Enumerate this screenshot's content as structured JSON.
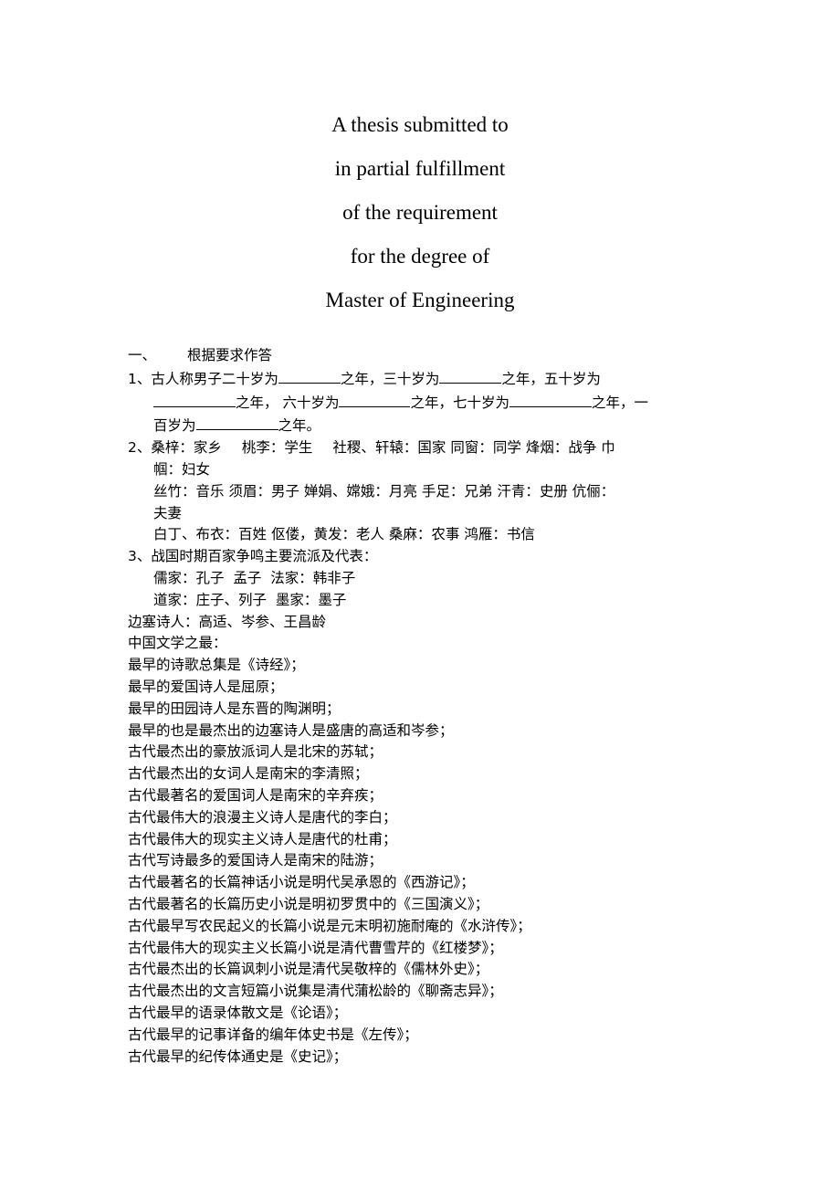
{
  "title_block": {
    "lines": [
      "A thesis submitted to",
      "in partial fulfillment",
      "of the requirement",
      "for the degree of",
      "Master of Engineering"
    ]
  },
  "section": {
    "number": "一、",
    "heading": "根据要求作答"
  },
  "q1": {
    "number": "1、",
    "line1_a": "古人称男子二十岁为",
    "line1_b": "之年，三十岁为",
    "line1_c": "之年，五十岁为",
    "line2_a": "之年，",
    "line2_b": "六十岁为",
    "line2_c": "之年，七十岁为",
    "line2_d": "之年，一",
    "line3_a": "百岁为",
    "line3_b": "之年。"
  },
  "q2": {
    "number": "2、",
    "line1": [
      "桑梓：家乡",
      "桃李：学生",
      "社稷、轩辕：国家",
      "同窗：同学",
      "烽烟：战争",
      "巾"
    ],
    "line2": "帼：妇女",
    "line3": [
      "丝竹：音乐",
      "须眉：男子",
      "婵娟、嫦娥：月亮",
      "手足：兄弟",
      "汗青：史册",
      "伉俪："
    ],
    "line4": "夫妻",
    "line5": [
      "白丁、布衣：百姓",
      "伛偻，黄发：老人",
      "桑麻：农事",
      "鸿雁：书信"
    ]
  },
  "q3": {
    "number": "3、",
    "heading": "战国时期百家争鸣主要流派及代表：",
    "line1": "儒家：孔子  孟子  法家：韩非子",
    "line2": "道家：庄子、列子  墨家：墨子"
  },
  "frontier_poets": "边塞诗人：高适、岑参、王昌龄",
  "literature_firsts": {
    "heading": "中国文学之最：",
    "items": [
      "最早的诗歌总集是《诗经》；",
      "最早的爱国诗人是屈原；",
      "最早的田园诗人是东晋的陶渊明；",
      "最早的也是最杰出的边塞诗人是盛唐的高适和岑参；",
      "古代最杰出的豪放派词人是北宋的苏轼；",
      "古代最杰出的女词人是南宋的李清照；",
      "古代最著名的爱国词人是南宋的辛弃疾；",
      "古代最伟大的浪漫主义诗人是唐代的李白；",
      "古代最伟大的现实主义诗人是唐代的杜甫；",
      "古代写诗最多的爱国诗人是南宋的陆游；",
      "古代最著名的长篇神话小说是明代吴承恩的《西游记》；",
      "古代最著名的长篇历史小说是明初罗贯中的《三国演义》；",
      "古代最早写农民起义的长篇小说是元末明初施耐庵的《水浒传》；",
      "古代最伟大的现实主义长篇小说是清代曹雪芹的《红楼梦》；",
      "古代最杰出的长篇讽刺小说是清代吴敬梓的《儒林外史》；",
      "古代最杰出的文言短篇小说集是清代蒲松龄的《聊斋志异》；",
      "古代最早的语录体散文是《论语》；",
      "古代最早的记事详备的编年体史书是《左传》；",
      "古代最早的纪传体通史是《史记》；"
    ]
  }
}
